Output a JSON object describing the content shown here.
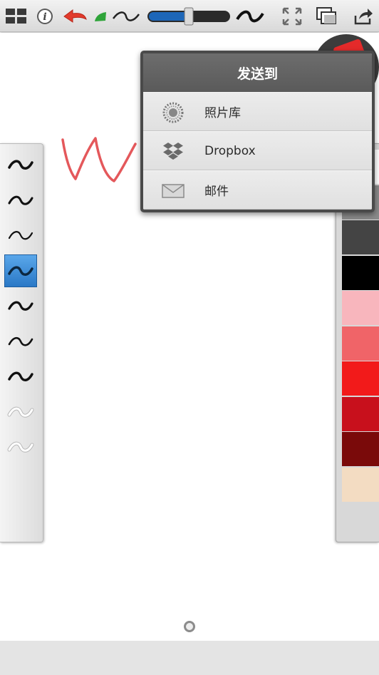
{
  "toolbar": {
    "icons": [
      "grid-icon",
      "info-icon",
      "undo-icon",
      "brush-stroke-icon",
      "brush-wave-icon",
      "size-slider",
      "brush-wave-large-icon",
      "fullscreen-icon",
      "layers-icon",
      "share-icon"
    ],
    "size_slider_value": 0.5,
    "slider_color": "#1d66b8"
  },
  "share_popup": {
    "title": "发送到",
    "items": [
      {
        "label": "照片库",
        "icon": "photo-gallery-icon"
      },
      {
        "label": "Dropbox",
        "icon": "dropbox-icon"
      },
      {
        "label": "邮件",
        "icon": "mail-icon"
      }
    ]
  },
  "brush_panel": {
    "selected_index": 3,
    "brush_count": 9
  },
  "color_panel": {
    "swatches": [
      "#ffffff",
      "#8a8a8a",
      "#444444",
      "#000000",
      "#f8b6bd",
      "#f06468",
      "#f21a1a",
      "#c8101c",
      "#7a0a0a",
      "#f3dcc2"
    ]
  },
  "canvas": {
    "stroke_color": "#e4585b"
  }
}
